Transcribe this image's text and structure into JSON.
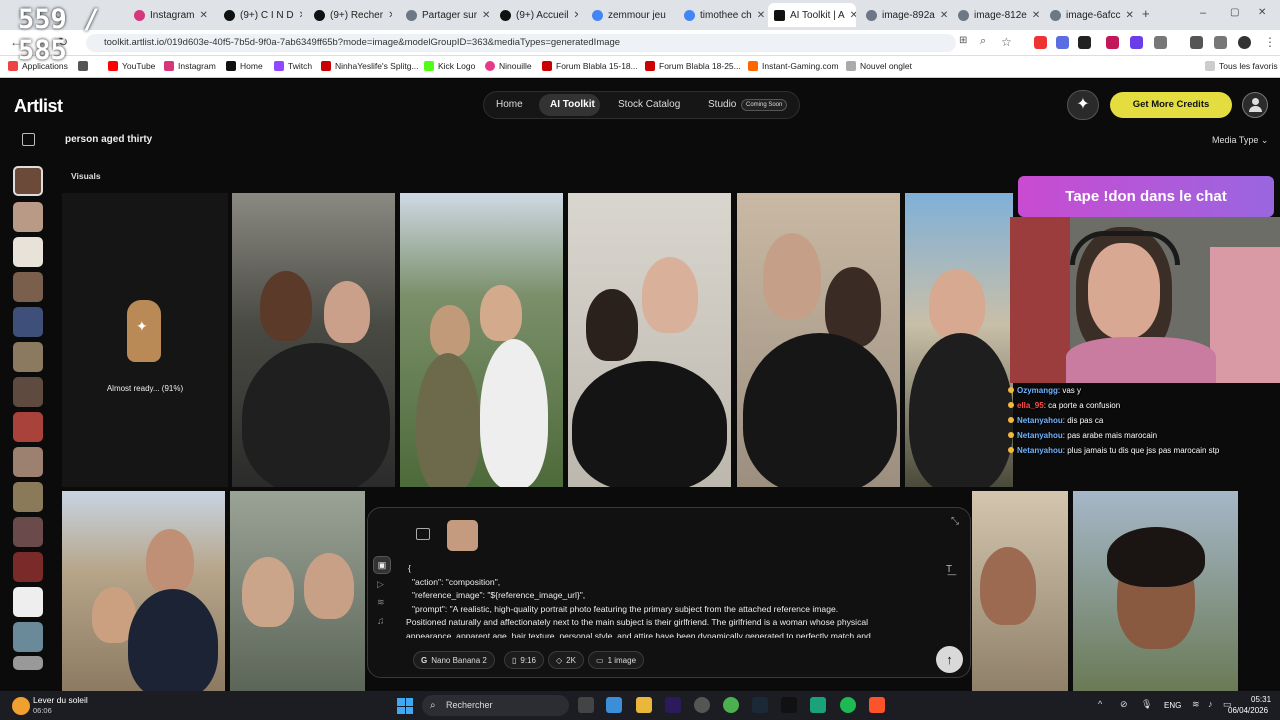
{
  "overlay_counter": "559 / 585",
  "browser": {
    "tabs": [
      {
        "label": "Instagram"
      },
      {
        "label": "(9+) C I N D"
      },
      {
        "label": "(9+) Recher"
      },
      {
        "label": "Partager sur"
      },
      {
        "label": "(9+) Accueil"
      },
      {
        "label": "zemmour jeu"
      },
      {
        "label": "timothee ch"
      },
      {
        "label": "AI Toolkit | A"
      },
      {
        "label": "image-892a"
      },
      {
        "label": "image-812e"
      },
      {
        "label": "image-6afcc"
      }
    ],
    "new_tab": "+",
    "url": "toolkit.artlist.io/019d603e-40f5-7b5d-9f0a-7ab6349ff65b?mode=image&modelGroupID=363&mediaTypes=generatedImage",
    "bookmarks": [
      "Applications",
      "YouTube",
      "Instagram",
      "Home",
      "Twitch",
      "NinhaYeslife's Splitg...",
      "Kick Logo",
      "Ninouille",
      "Forum Blabla 15-18...",
      "Forum Blabla 18-25...",
      "Instant-Gaming.com",
      "Nouvel onglet"
    ],
    "all_bookmarks": "Tous les favoris"
  },
  "app": {
    "logo": "Artlist",
    "nav": {
      "home": "Home",
      "ai_toolkit": "AI Toolkit",
      "stock": "Stock Catalog",
      "studio": "Studio",
      "coming_soon": "Coming Soon"
    },
    "get_credits": "Get More Credits",
    "query": "person aged thirty",
    "media_type": "Media Type",
    "section": "Visuals",
    "loading_text": "Almost ready... (91%)",
    "prompt_lines": [
      "{",
      "\"action\": \"composition\",",
      "\"reference_image\": \"${reference_image_url}\",",
      "\"prompt\": \"A realistic, high-quality portrait photo featuring the primary subject from the attached reference image.",
      "Positioned naturally and affectionately next to the main subject is their girlfriend. The girlfriend is a woman whose physical",
      "appearance, apparent age, hair texture, personal style, and attire have been dynamically generated to perfectly match and"
    ],
    "chips": {
      "model": "Nano Banana 2",
      "ratio": "9:16",
      "resolution": "2K",
      "count": "1 image"
    }
  },
  "stream": {
    "banner": "Tape !don dans le chat",
    "chat": [
      {
        "user": "Ozymangg",
        "msg": "vas y"
      },
      {
        "user": "ella_95",
        "msg": "ca porte a confusion"
      },
      {
        "user": "Netanyahou",
        "msg": "dis pas ca"
      },
      {
        "user": "Netanyahou",
        "msg": "pas arabe mais marocain"
      },
      {
        "user": "Netanyahou",
        "msg": "plus jamais tu dis que jss pas marocain stp"
      }
    ]
  },
  "taskbar": {
    "weather_title": "Lever du soleil",
    "weather_time": "06:06",
    "search": "Rechercher",
    "lang": "ENG",
    "time": "05:31",
    "date": "06/04/2026"
  }
}
